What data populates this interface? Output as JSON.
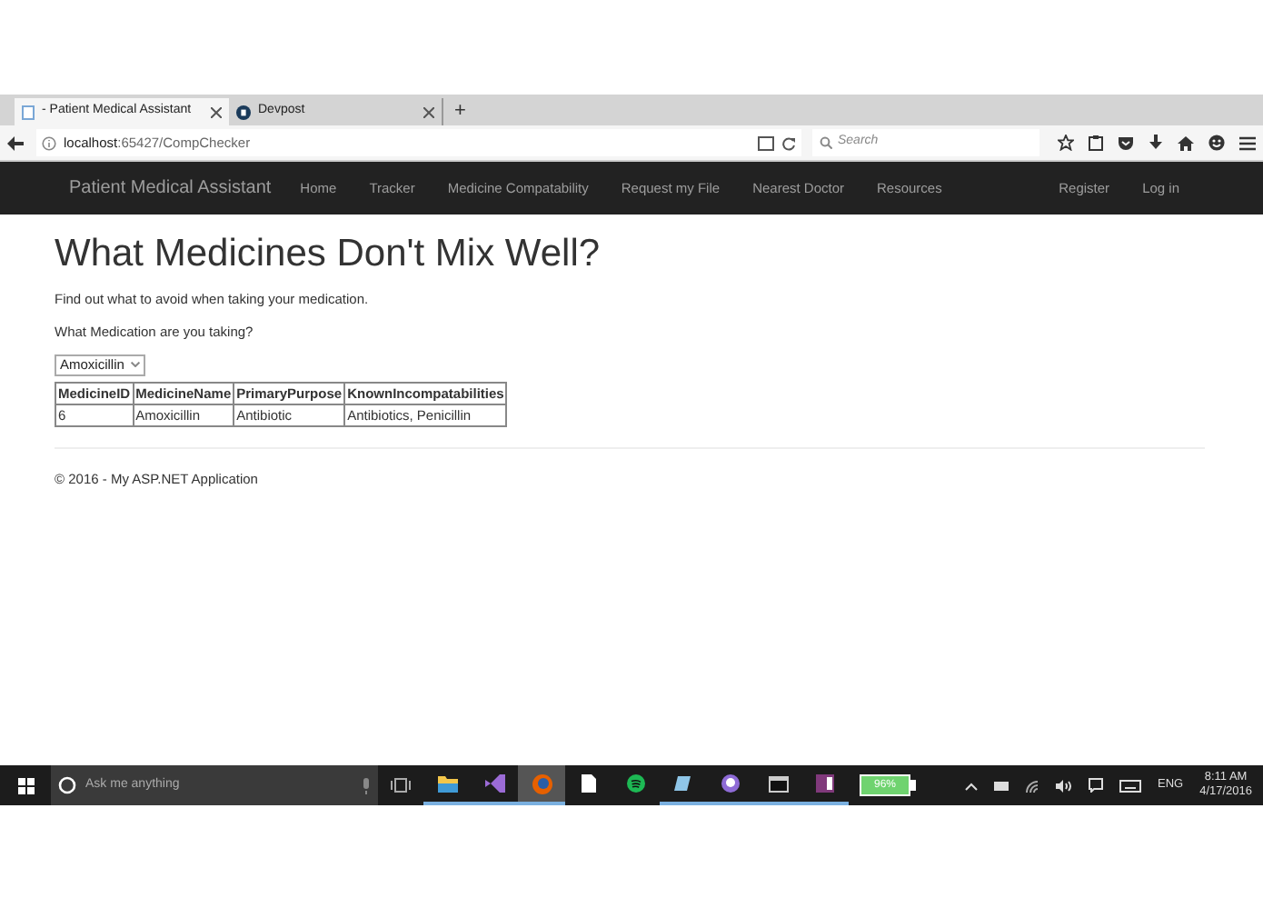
{
  "browser": {
    "tabs": [
      {
        "title": "- Patient Medical Assistant",
        "selected": true,
        "kind": "page"
      },
      {
        "title": "Devpost",
        "selected": false,
        "kind": "devpost"
      }
    ],
    "new_tab": "+",
    "address": {
      "host": "localhost",
      "rest": ":65427/CompChecker"
    },
    "search": {
      "placeholder": "Search"
    }
  },
  "navbar": {
    "brand": "Patient Medical Assistant",
    "links": [
      "Home",
      "Tracker",
      "Medicine Compatability",
      "Request my File",
      "Nearest Doctor",
      "Resources"
    ],
    "right_links": [
      "Register",
      "Log in"
    ]
  },
  "page": {
    "heading": "What Medicines Don't Mix Well?",
    "intro": "Find out what to avoid when taking your medication.",
    "question": "What Medication are you taking?",
    "select": {
      "value": "Amoxicillin"
    },
    "table": {
      "columns": [
        "MedicineID",
        "MedicineName",
        "PrimaryPurpose",
        "KnownIncompatabilities"
      ],
      "rows": [
        [
          "6",
          "Amoxicillin",
          "Antibiotic",
          "Antibiotics, Penicillin"
        ]
      ]
    },
    "footer": "© 2016 - My ASP.NET Application"
  },
  "taskbar": {
    "search": {
      "placeholder": "Ask me anything"
    },
    "apps": [
      {
        "kind": "folder",
        "running": true,
        "active": false
      },
      {
        "kind": "vs",
        "running": true,
        "active": false
      },
      {
        "kind": "firefox",
        "running": true,
        "active": true
      },
      {
        "kind": "document",
        "running": false,
        "active": false
      },
      {
        "kind": "spotify",
        "running": false,
        "active": false
      },
      {
        "kind": "notes",
        "running": true,
        "active": false
      },
      {
        "kind": "github",
        "running": true,
        "active": false
      },
      {
        "kind": "terminal",
        "running": true,
        "active": false
      },
      {
        "kind": "onenote",
        "running": true,
        "active": false
      }
    ],
    "battery": "96%",
    "language": "ENG",
    "time": "8:11 AM",
    "date": "4/17/2016"
  }
}
